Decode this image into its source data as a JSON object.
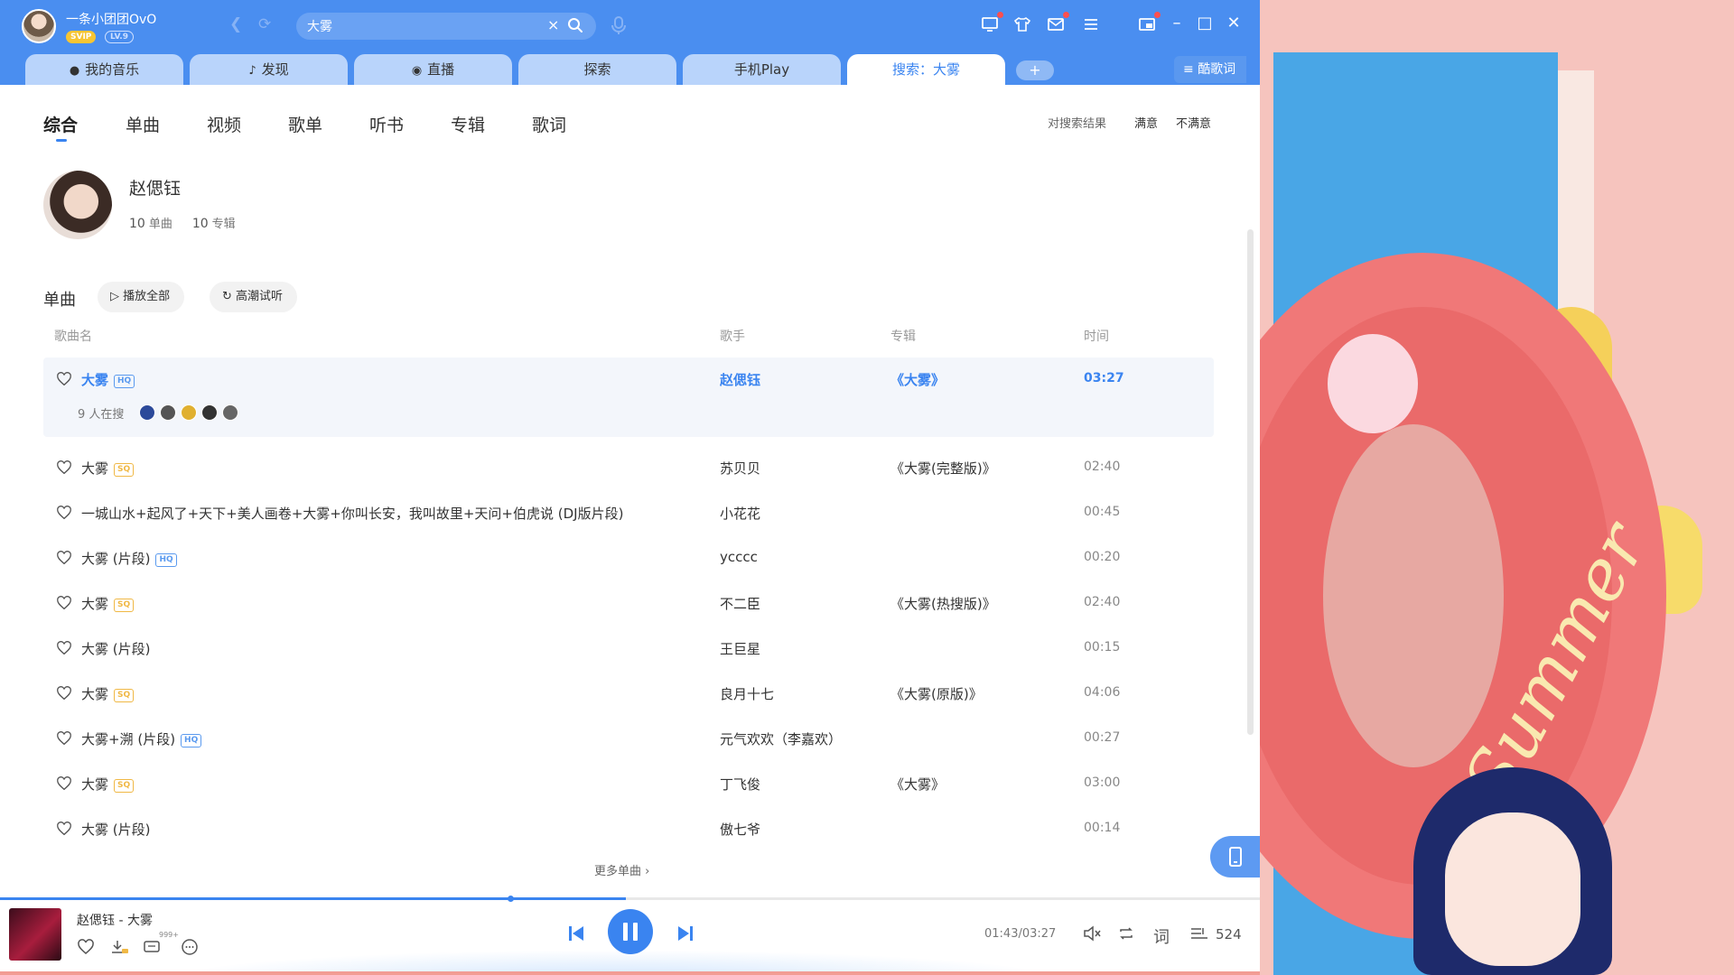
{
  "user": {
    "name": "一条小团团OvO",
    "vip": "SVIP",
    "level": "LV.9"
  },
  "search": {
    "query": "大雾"
  },
  "tabs": [
    {
      "label": "我的音乐"
    },
    {
      "label": "发现"
    },
    {
      "label": "直播"
    },
    {
      "label": "探索"
    },
    {
      "label": "手机Play"
    },
    {
      "label": "搜索：大雾"
    }
  ],
  "lyrics_button": "酷歌词",
  "categories": [
    "综合",
    "单曲",
    "视频",
    "歌单",
    "听书",
    "专辑",
    "歌词"
  ],
  "feedback": {
    "label": "对搜索结果",
    "good": "满意",
    "bad": "不满意"
  },
  "artist": {
    "name": "赵偲钰",
    "singles_count": "10",
    "singles_label": "单曲",
    "albums_count": "10",
    "albums_label": "专辑"
  },
  "singles": {
    "label": "单曲",
    "play_all": "播放全部",
    "climax": "高潮试听"
  },
  "columns": {
    "title": "歌曲名",
    "artist": "歌手",
    "album": "专辑",
    "time": "时间"
  },
  "searching_text": "9 人在搜",
  "songs": [
    {
      "title": "大雾",
      "quality": "HQ",
      "artist": "赵偲钰",
      "album": "《大雾》",
      "time": "03:27"
    },
    {
      "title": "大雾",
      "quality": "SQ",
      "artist": "苏贝贝",
      "album": "《大雾(完整版)》",
      "time": "02:40"
    },
    {
      "title": "一城山水+起风了+天下+美人画卷+大雾+你叫长安，我叫故里+天问+伯虎说 (DJ版片段)",
      "quality": "",
      "artist": "小花花",
      "album": "",
      "time": "00:45"
    },
    {
      "title": "大雾 (片段)",
      "quality": "HQ",
      "artist": "ycccc",
      "album": "",
      "time": "00:20"
    },
    {
      "title": "大雾",
      "quality": "SQ",
      "artist": "不二臣",
      "album": "《大雾(热搜版)》",
      "time": "02:40"
    },
    {
      "title": "大雾 (片段)",
      "quality": "",
      "artist": "王巨星",
      "album": "",
      "time": "00:15"
    },
    {
      "title": "大雾",
      "quality": "SQ",
      "artist": "良月十七",
      "album": "《大雾(原版)》",
      "time": "04:06"
    },
    {
      "title": "大雾+溯 (片段)",
      "quality": "HQ",
      "artist": "元气欢欢（李嘉欢）",
      "album": "",
      "time": "00:27"
    },
    {
      "title": "大雾",
      "quality": "SQ",
      "artist": "丁飞俊",
      "album": "《大雾》",
      "time": "03:00"
    },
    {
      "title": "大雾 (片段)",
      "quality": "",
      "artist": "傲七爷",
      "album": "",
      "time": "00:14"
    }
  ],
  "more_singles": "更多单曲",
  "player": {
    "now_playing": "赵偲钰 - 大雾",
    "comment_badge": "999+",
    "time": "01:43/03:27",
    "playlist_count": "524",
    "progress": 0.497,
    "buffered": 0.405
  },
  "wallpaper": {
    "text": "Summer"
  },
  "colors": {
    "brand": "#4a8ef0",
    "accent": "#3a84f0",
    "hq": "#5a9aef",
    "sq": "#f0b845"
  }
}
